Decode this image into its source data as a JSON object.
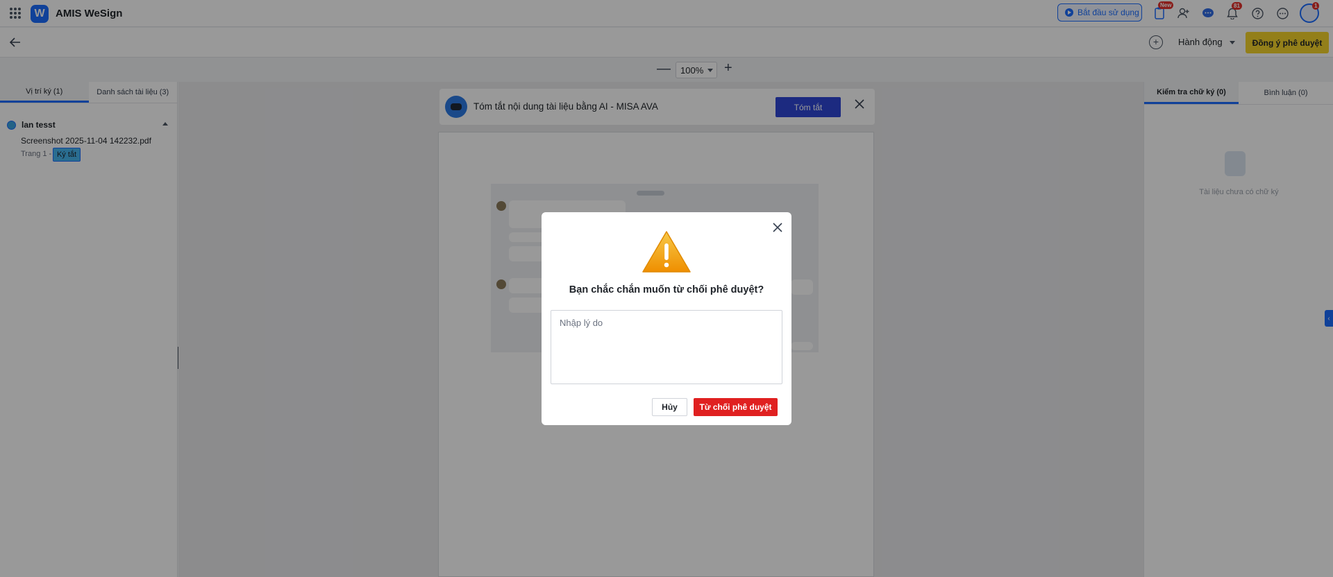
{
  "header": {
    "app_title": "AMIS WeSign",
    "logo_letter": "W",
    "start_button": "Bắt đầu sử dụng",
    "new_badge": "New",
    "notification_count": "81",
    "avatar_badge": "1"
  },
  "toolbar": {
    "action_dropdown": "Hành động",
    "approve_button": "Đồng ý phê duyệt"
  },
  "zoom": {
    "minus": "—",
    "value": "100%",
    "plus": "+"
  },
  "left_panel": {
    "tabs": [
      "Vị trí ký (1)",
      "Danh sách tài liệu (3)"
    ],
    "signer_name": "lan tesst",
    "file_name": "Screenshot 2025-11-04 142232.pdf",
    "page_label": "Trang 1 -",
    "sign_tag": "Ký tắt"
  },
  "ai_banner": {
    "text": "Tóm tắt nội dung tài liệu bằng AI - MISA AVA",
    "button": "Tóm tắt"
  },
  "right_panel": {
    "tabs": [
      "Kiểm tra chữ ký (0)",
      "Bình luận (0)"
    ],
    "empty_text": "Tài liệu chưa có chữ ký"
  },
  "modal": {
    "title": "Bạn chắc chắn muốn từ chối phê duyệt?",
    "reason_placeholder": "Nhập lý do",
    "reason_value": "",
    "cancel_button": "Hủy",
    "reject_button": "Từ chối phê duyệt"
  },
  "colors": {
    "primary": "#1b6dff",
    "approve": "#f5d42c",
    "reject": "#e02020",
    "warning": "#f0a500"
  },
  "icons": {
    "apps": "grid-icon",
    "back": "arrow-left-icon",
    "close": "close-icon",
    "warning": "warning-triangle-icon"
  }
}
